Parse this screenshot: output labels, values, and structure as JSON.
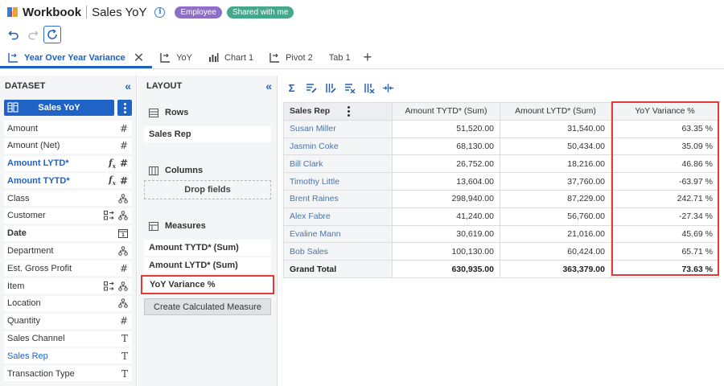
{
  "app": {
    "name": "Workbook",
    "title": "Sales YoY"
  },
  "badges": [
    {
      "label": "Employee",
      "color": "#8e6fc6"
    },
    {
      "label": "Shared with me",
      "color": "#45a78b"
    }
  ],
  "toolbar": {
    "icons": [
      "undo-icon",
      "redo-icon",
      "refresh-icon"
    ]
  },
  "tabs": [
    {
      "label": "Year Over Year Variance",
      "icon": "pivot-icon",
      "active": true
    },
    {
      "label": "YoY",
      "icon": "pivot-icon"
    },
    {
      "label": "Chart 1",
      "icon": "bar-chart-icon"
    },
    {
      "label": "Pivot 2",
      "icon": "pivot-icon"
    },
    {
      "label": "Tab 1",
      "icon": ""
    }
  ],
  "dataset": {
    "header": "DATASET",
    "selected": "Sales YoY",
    "fields": [
      {
        "label": "Amount",
        "icons": [
          "#"
        ]
      },
      {
        "label": "Amount (Net)",
        "icons": [
          "#"
        ]
      },
      {
        "label": "Amount LYTD*",
        "icons": [
          "fx",
          "#"
        ],
        "style": "blue"
      },
      {
        "label": "Amount TYTD*",
        "icons": [
          "fx",
          "#"
        ],
        "style": "blue"
      },
      {
        "label": "Class",
        "icons": [
          "hier"
        ]
      },
      {
        "label": "Customer",
        "icons": [
          "grp",
          "hier"
        ]
      },
      {
        "label": "Date",
        "icons": [
          "cal"
        ],
        "style": "bold"
      },
      {
        "label": "Department",
        "icons": [
          "hier"
        ]
      },
      {
        "label": "Est. Gross Profit",
        "icons": [
          "#"
        ]
      },
      {
        "label": "Item",
        "icons": [
          "grp",
          "hier"
        ]
      },
      {
        "label": "Location",
        "icons": [
          "hier"
        ]
      },
      {
        "label": "Quantity",
        "icons": [
          "#"
        ]
      },
      {
        "label": "Sales Channel",
        "icons": [
          "T"
        ]
      },
      {
        "label": "Sales Rep",
        "icons": [
          "T"
        ],
        "style": "selblue"
      },
      {
        "label": "Transaction Type",
        "icons": [
          "T"
        ]
      }
    ]
  },
  "layout": {
    "header": "LAYOUT",
    "rows_label": "Rows",
    "rows": [
      "Sales Rep"
    ],
    "columns_label": "Columns",
    "columns_placeholder": "Drop fields",
    "measures_label": "Measures",
    "measures": [
      "Amount TYTD*  (Sum)",
      "Amount LYTD*  (Sum)",
      "YoY Variance %"
    ],
    "calc_button": "Create Calculated Measure"
  },
  "pivot": {
    "row_header": "Sales Rep",
    "columns": [
      "Amount TYTD* (Sum)",
      "Amount LYTD* (Sum)",
      "YoY Variance %"
    ],
    "rows": [
      [
        "Susan Miller",
        "51,520.00",
        "31,540.00",
        "63.35 %"
      ],
      [
        "Jasmin Coke",
        "68,130.00",
        "50,434.00",
        "35.09 %"
      ],
      [
        "Bill Clark",
        "26,752.00",
        "18,216.00",
        "46.86 %"
      ],
      [
        "Timothy Little",
        "13,604.00",
        "37,760.00",
        "-63.97 %"
      ],
      [
        "Brent Raines",
        "298,940.00",
        "87,229.00",
        "242.71 %"
      ],
      [
        "Alex Fabre",
        "41,240.00",
        "56,760.00",
        "-27.34 %"
      ],
      [
        "Evaline Mann",
        "30,619.00",
        "21,016.00",
        "45.69 %"
      ],
      [
        "Bob Sales",
        "100,130.00",
        "60,424.00",
        "65.71 %"
      ]
    ],
    "total": [
      "Grand Total",
      "630,935.00",
      "363,379.00",
      "73.63 %"
    ]
  },
  "colors": {
    "accent": "#1f63c6",
    "highlight": "#e53935",
    "panel": "#f4f5f7"
  }
}
